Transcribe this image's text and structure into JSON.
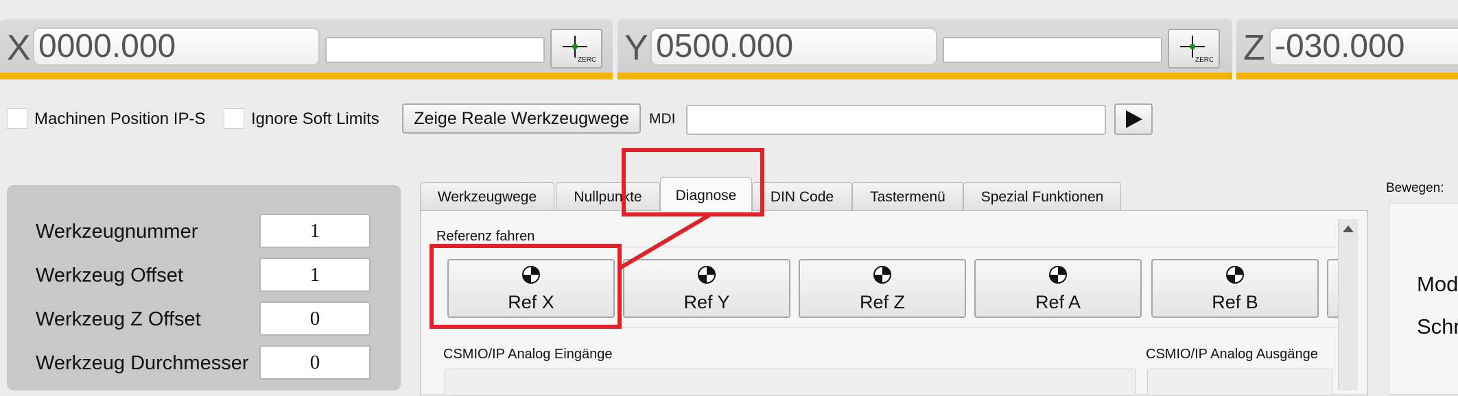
{
  "dro": {
    "x": {
      "letter": "X",
      "value": "0000.000",
      "zero_label": "ZERO"
    },
    "y": {
      "letter": "Y",
      "value": "0500.000",
      "zero_label": "ZERO"
    },
    "z": {
      "letter": "Z",
      "value": "-030.000"
    }
  },
  "options": {
    "machine_position_label": "Machinen Position IP-S",
    "ignore_soft_limits_label": "Ignore Soft Limits",
    "show_toolpaths_button": "Zeige Reale Werkzeugwege",
    "mdi_label": "MDI",
    "mdi_value": ""
  },
  "tool_panel": {
    "rows": [
      {
        "label": "Werkzeugnummer",
        "value": "1"
      },
      {
        "label": "Werkzeug Offset",
        "value": "1"
      },
      {
        "label": "Werkzeug Z Offset",
        "value": "0"
      },
      {
        "label": "Werkzeug Durchmesser",
        "value": "0"
      }
    ]
  },
  "tabs": [
    {
      "label": "Werkzeugwege"
    },
    {
      "label": "Nullpunkte"
    },
    {
      "label": "Diagnose"
    },
    {
      "label": "DIN Code"
    },
    {
      "label": "Tastermenü"
    },
    {
      "label": "Spezial Funktionen"
    }
  ],
  "active_tab": "Diagnose",
  "diagnose": {
    "referenz_title": "Referenz fahren",
    "ref_buttons": [
      {
        "label": "Ref X"
      },
      {
        "label": "Ref Y"
      },
      {
        "label": "Ref Z"
      },
      {
        "label": "Ref A"
      },
      {
        "label": "Ref B"
      }
    ],
    "analog_inputs_title": "CSMIO/IP Analog Eingänge",
    "analog_outputs_title": "CSMIO/IP Analog Ausgänge"
  },
  "right_panel": {
    "title": "Bewegen:",
    "line1": "Mod",
    "line2": "Schr"
  },
  "colors": {
    "accent_bar": "#f2b400",
    "highlight": "#e0232a"
  }
}
